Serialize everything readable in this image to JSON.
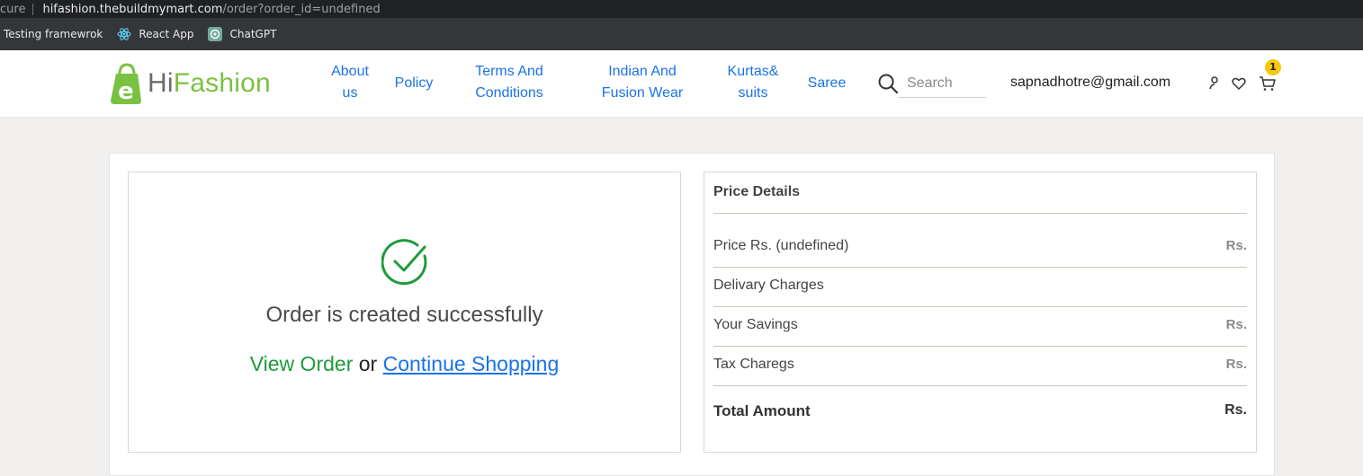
{
  "browser": {
    "secure_label": "cure",
    "url_host": "hifashion.thebuildmymart.com",
    "url_path": "/order?order_id=undefined"
  },
  "bookmarks": [
    {
      "label": "Testing framewrok",
      "icon": "none"
    },
    {
      "label": "React App",
      "icon": "react-icon"
    },
    {
      "label": "ChatGPT",
      "icon": "chatgpt-icon"
    }
  ],
  "header": {
    "logo_prefix": "Hi",
    "logo_suffix": "Fashion",
    "nav": [
      {
        "label_line1": "About",
        "label_line2": "us"
      },
      {
        "label_line1": "Policy",
        "label_line2": ""
      },
      {
        "label_line1": "Terms And",
        "label_line2": "Conditions"
      },
      {
        "label_line1": "Indian And",
        "label_line2": "Fusion Wear"
      },
      {
        "label_line1": "Kurtas&",
        "label_line2": "suits"
      },
      {
        "label_line1": "Saree",
        "label_line2": ""
      }
    ],
    "search_placeholder": "Search",
    "user_email": "sapnadhotre@gmail.com",
    "cart_count": "1",
    "colors": {
      "brand_green": "#7ac142",
      "link_blue": "#1a73e8",
      "badge_yellow": "#f6c90e"
    }
  },
  "order": {
    "message": "Order is created successfully",
    "view_order": "View Order",
    "or_text": " or ",
    "continue_shopping": "Continue Shopping",
    "success_color": "#1e9b3c"
  },
  "price_details": {
    "title": "Price Details",
    "rows": [
      {
        "label": "Price Rs. (undefined)",
        "value": "Rs."
      },
      {
        "label": "Delivary Charges",
        "value": ""
      },
      {
        "label": "Your Savings",
        "value": "Rs."
      },
      {
        "label": "Tax Charegs",
        "value": "Rs."
      }
    ],
    "total": {
      "label": "Total Amount",
      "value": "Rs."
    }
  }
}
